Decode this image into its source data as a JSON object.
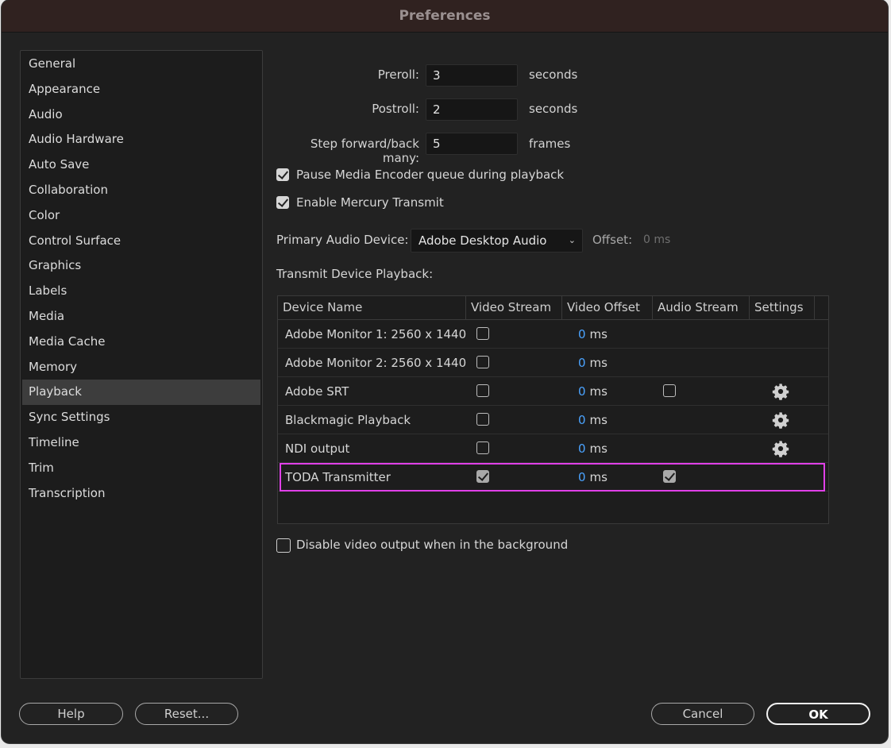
{
  "window": {
    "title": "Preferences"
  },
  "sidebar": {
    "items": [
      {
        "label": "General"
      },
      {
        "label": "Appearance"
      },
      {
        "label": "Audio"
      },
      {
        "label": "Audio Hardware"
      },
      {
        "label": "Auto Save"
      },
      {
        "label": "Collaboration"
      },
      {
        "label": "Color"
      },
      {
        "label": "Control Surface"
      },
      {
        "label": "Graphics"
      },
      {
        "label": "Labels"
      },
      {
        "label": "Media"
      },
      {
        "label": "Media Cache"
      },
      {
        "label": "Memory"
      },
      {
        "label": "Playback"
      },
      {
        "label": "Sync Settings"
      },
      {
        "label": "Timeline"
      },
      {
        "label": "Trim"
      },
      {
        "label": "Transcription"
      }
    ],
    "selected": "Playback"
  },
  "playback": {
    "preroll": {
      "label": "Preroll:",
      "value": "3",
      "unit": "seconds"
    },
    "postroll": {
      "label": "Postroll:",
      "value": "2",
      "unit": "seconds"
    },
    "step": {
      "label": "Step forward/back many:",
      "value": "5",
      "unit": "frames"
    },
    "pause_encoder": {
      "label": "Pause Media Encoder queue during playback",
      "checked": true
    },
    "mercury": {
      "label": "Enable Mercury Transmit",
      "checked": true
    },
    "audio_device": {
      "label": "Primary Audio Device:",
      "value": "Adobe Desktop Audio",
      "offset_label": "Offset:",
      "offset_value": "0 ms"
    },
    "transmit_label": "Transmit Device Playback:",
    "disable_bg": {
      "label": "Disable video output when in the background",
      "checked": false
    }
  },
  "table": {
    "headers": [
      "Device Name",
      "Video Stream",
      "Video Offset",
      "Audio Stream",
      "Settings"
    ],
    "rows": [
      {
        "name": "Adobe Monitor 1: 2560 x 1440",
        "video": false,
        "offset": "0",
        "unit": "ms",
        "audio": null,
        "settings": false
      },
      {
        "name": "Adobe Monitor 2: 2560 x 1440",
        "video": false,
        "offset": "0",
        "unit": "ms",
        "audio": null,
        "settings": false
      },
      {
        "name": "Adobe SRT",
        "video": false,
        "offset": "0",
        "unit": "ms",
        "audio": false,
        "settings": true
      },
      {
        "name": "Blackmagic Playback",
        "video": false,
        "offset": "0",
        "unit": "ms",
        "audio": null,
        "settings": true
      },
      {
        "name": "NDI output",
        "video": false,
        "offset": "0",
        "unit": "ms",
        "audio": null,
        "settings": true
      },
      {
        "name": "TODA Transmitter",
        "video": true,
        "offset": "0",
        "unit": "ms",
        "audio": true,
        "settings": false,
        "highlighted": true
      }
    ]
  },
  "buttons": {
    "help": "Help",
    "reset": "Reset...",
    "cancel": "Cancel",
    "ok": "OK"
  },
  "colors": {
    "highlight": "#e040e8",
    "offset_number": "#4aa3ff"
  }
}
